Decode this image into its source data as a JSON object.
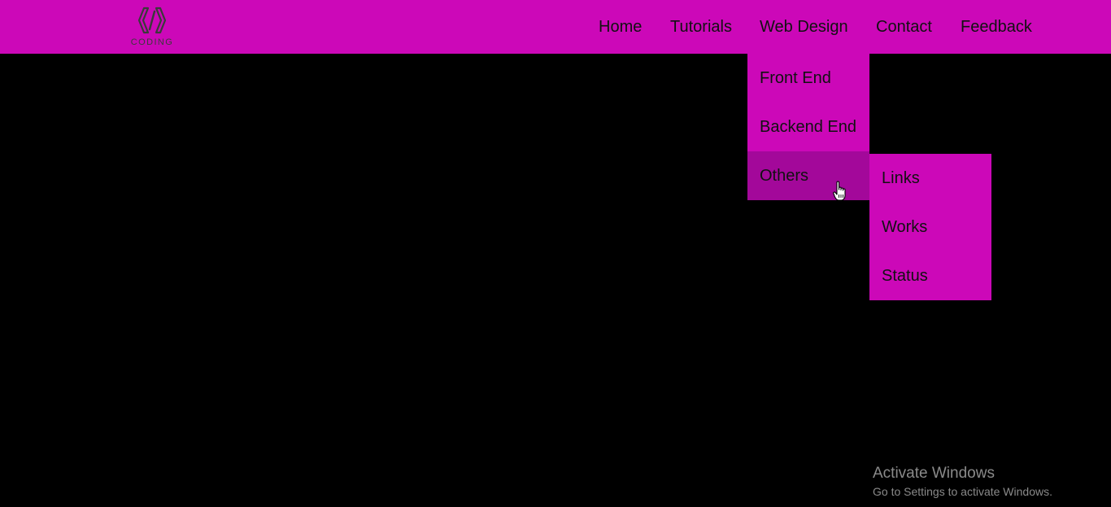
{
  "colors": {
    "header_bg": "#cc08b8",
    "menu_bg": "#cc08b8",
    "menu_active_bg": "#a3089a",
    "page_bg": "#000000",
    "text": "#111111",
    "watermark": "#8a8a8a"
  },
  "logo": {
    "icon": "code-brackets-hexagon-icon",
    "text": "CODING"
  },
  "nav": {
    "items": [
      {
        "label": "Home"
      },
      {
        "label": "Tutorials"
      },
      {
        "label": "Web Design"
      },
      {
        "label": "Contact"
      },
      {
        "label": "Feedback"
      }
    ]
  },
  "dropdown": {
    "items": [
      {
        "label": "Front End"
      },
      {
        "label": "Backend End"
      },
      {
        "label": "Others"
      }
    ]
  },
  "submenu": {
    "items": [
      {
        "label": "Links"
      },
      {
        "label": "Works"
      },
      {
        "label": "Status"
      }
    ]
  },
  "cursor": {
    "icon": "hand-pointer-icon"
  },
  "watermark": {
    "title": "Activate Windows",
    "subtitle": "Go to Settings to activate Windows."
  }
}
